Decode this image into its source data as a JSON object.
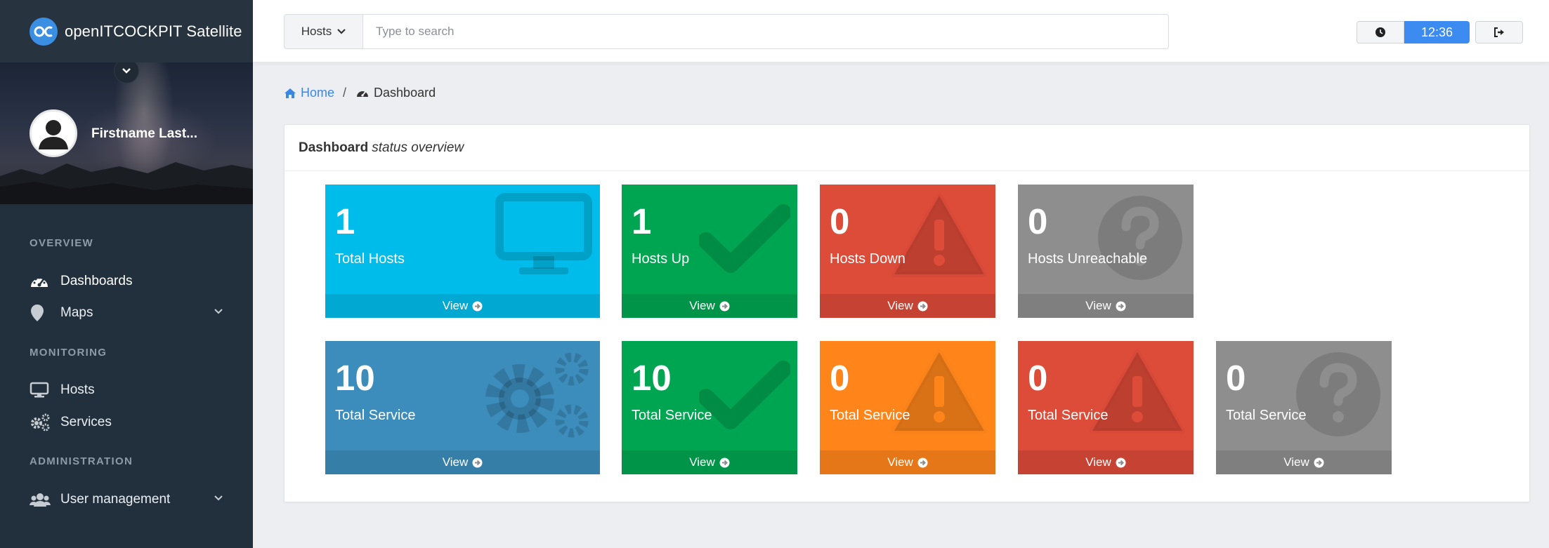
{
  "brand": {
    "name": "openITCOCKPIT Satellite"
  },
  "user": {
    "name": "Firstname Last..."
  },
  "nav": {
    "overview": "OVERVIEW",
    "dashboards": "Dashboards",
    "maps": "Maps",
    "monitoring": "MONITORING",
    "hosts": "Hosts",
    "services": "Services",
    "administration": "ADMINISTRATION",
    "user_management": "User management"
  },
  "topbar": {
    "search_scope": "Hosts",
    "search_placeholder": "Type to search",
    "time": "12:36"
  },
  "breadcrumb": {
    "home": "Home",
    "separator": "/",
    "current": "Dashboard"
  },
  "panel": {
    "title_bold": "Dashboard",
    "title_italic": "status overview"
  },
  "tiles": [
    {
      "number": "1",
      "label": "Total Hosts",
      "link": "View",
      "color": "#00bcea",
      "icon": "desktop-icon"
    },
    {
      "number": "1",
      "label": "Hosts Up",
      "link": "View",
      "color": "#00a551",
      "icon": "check-icon"
    },
    {
      "number": "0",
      "label": "Hosts Down",
      "link": "View",
      "color": "#dd4b39",
      "icon": "warning-icon"
    },
    {
      "number": "0",
      "label": "Hosts Unreachable",
      "link": "View",
      "color": "#8e8e8e",
      "icon": "question-icon"
    },
    {
      "number": "10",
      "label": "Total Service",
      "link": "View",
      "color": "#3c8dbc",
      "icon": "cogs-icon"
    },
    {
      "number": "10",
      "label": "Total Service",
      "link": "View",
      "color": "#00a551",
      "icon": "check-icon"
    },
    {
      "number": "0",
      "label": "Total Service",
      "link": "View",
      "color": "#ff851b",
      "icon": "warning-icon"
    },
    {
      "number": "0",
      "label": "Total Service",
      "link": "View",
      "color": "#dd4b39",
      "icon": "warning-icon"
    },
    {
      "number": "0",
      "label": "Total Service",
      "link": "View",
      "color": "#8e8e8e",
      "icon": "question-icon"
    }
  ]
}
